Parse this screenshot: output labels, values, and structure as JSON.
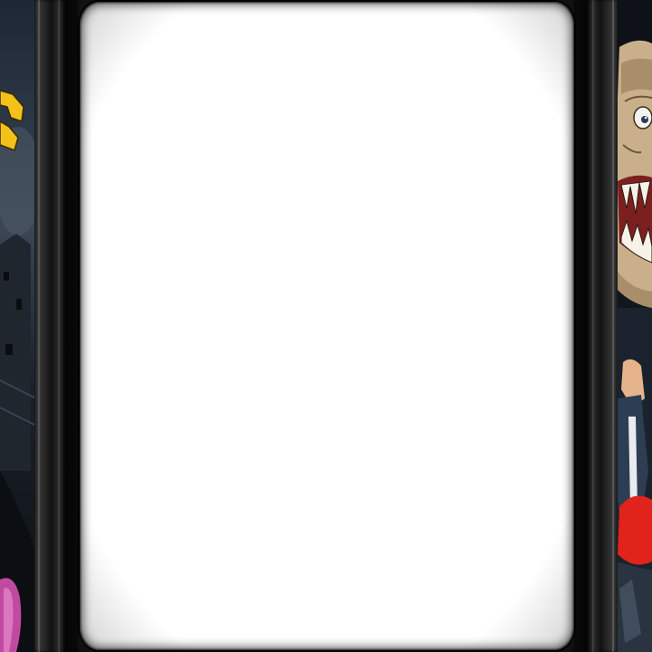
{
  "cabinet": {
    "screen_state": "blank",
    "screen_color": "#ffffff",
    "bezel_color": "#1b1b1b"
  },
  "side_art": {
    "left": {
      "subject": "dark-forest-haunted-house-art",
      "accent_colors": [
        "#f2c21b",
        "#3b4a5c",
        "#c04aa0"
      ]
    },
    "right": {
      "subject": "grinning-monster-face-art",
      "accent_colors": [
        "#c9b08a",
        "#7c1f1f",
        "#e0231b",
        "#2d3d52"
      ]
    }
  }
}
